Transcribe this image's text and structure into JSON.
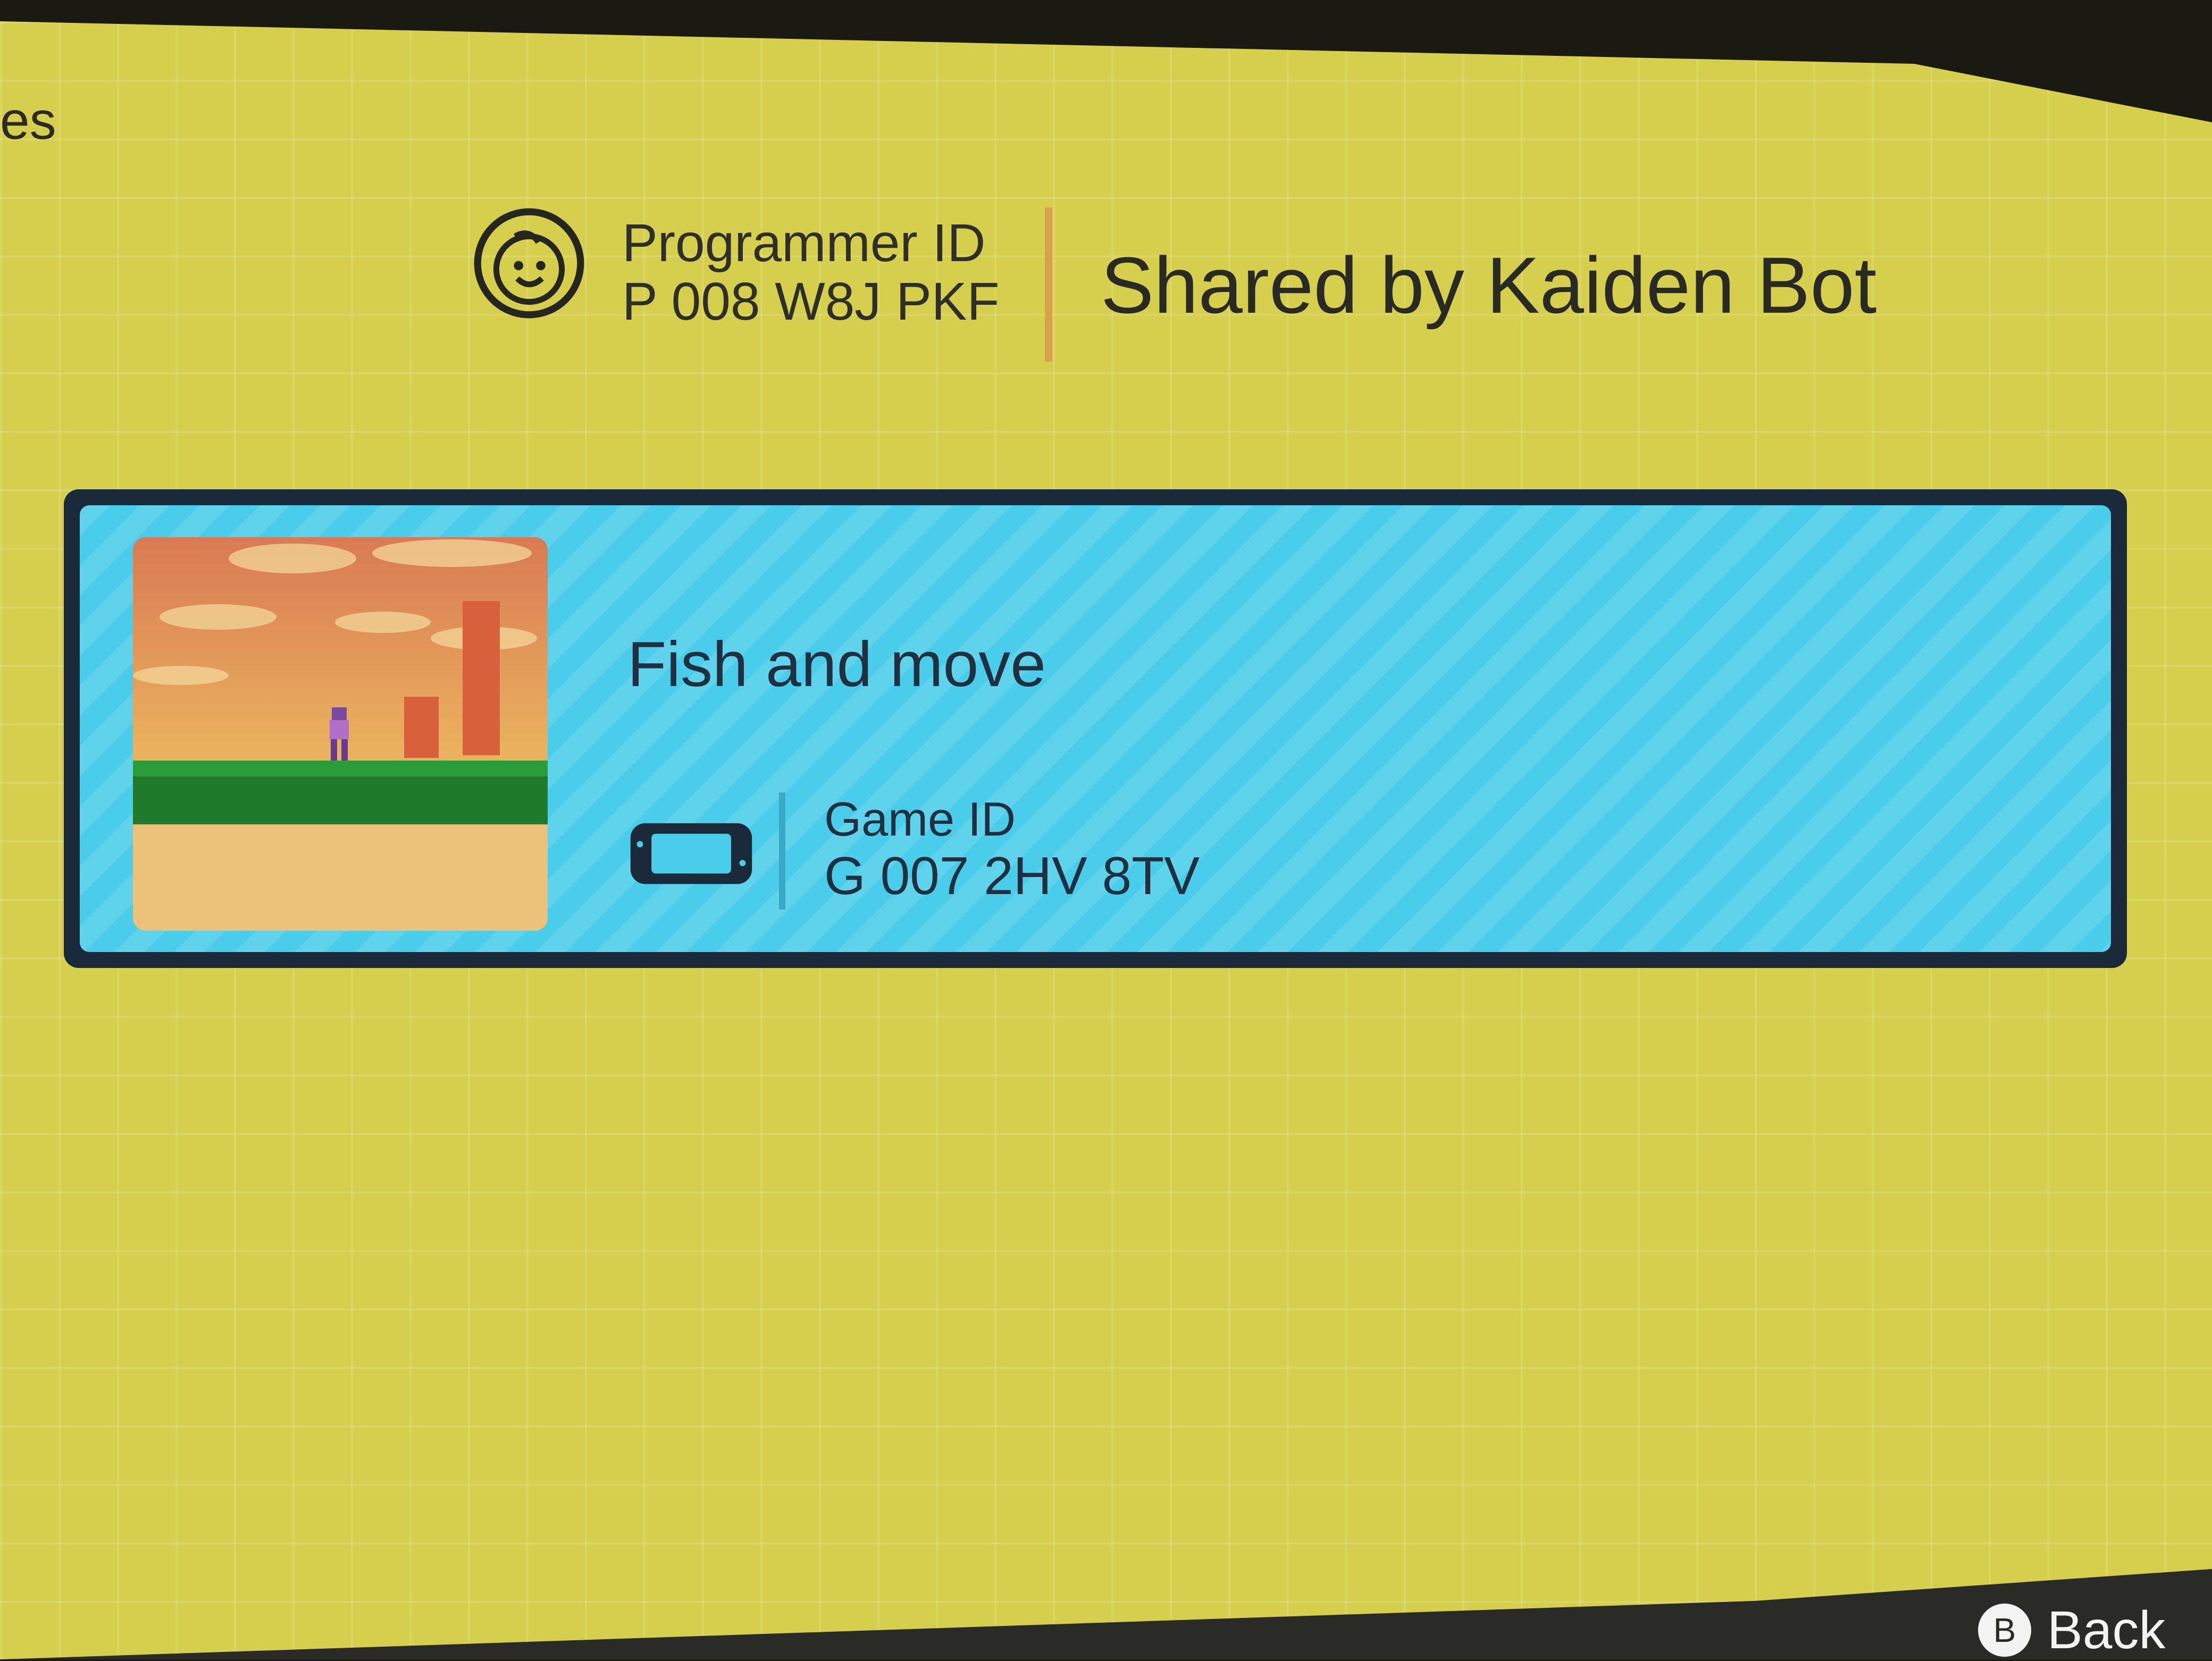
{
  "header": {
    "tab_fragment": "es",
    "programmer_id_label": "Programmer ID",
    "programmer_id_value": "P 008 W8J PKF",
    "shared_by": "Shared by Kaiden Bot",
    "programmer_icon": "smiley-face-icon"
  },
  "game": {
    "title": "Fish and move",
    "device_icon": "handheld-console-icon",
    "game_id_label": "Game ID",
    "game_id_value": "G 007 2HV 8TV"
  },
  "footer": {
    "button_glyph": "B",
    "back_label": "Back"
  },
  "colors": {
    "background": "#d6cf4e",
    "card": "#49cdea",
    "card_border": "#1b2a3a",
    "divider_accent": "#d8a24a"
  }
}
